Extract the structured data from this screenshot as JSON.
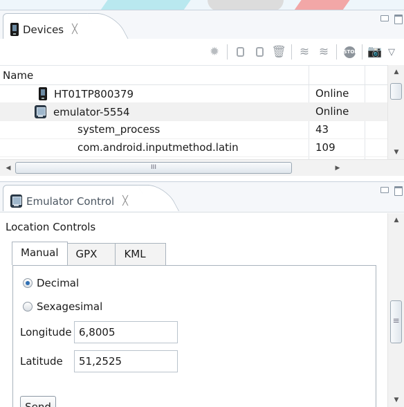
{
  "devices_view": {
    "tab_title": "Devices",
    "close_glyph": "╳",
    "toolbar_icons": [
      "debug-icon",
      "heap-icon",
      "heap-dump-icon",
      "gc-icon",
      "threads-icon",
      "thread-update-icon",
      "stop-process-icon",
      "screen-capture-icon",
      "view-menu-icon"
    ],
    "table": {
      "headers": [
        "Name"
      ],
      "rows": [
        {
          "name": "HT01TP800379",
          "status": "Online",
          "icon": "phone-device-icon"
        },
        {
          "name": "emulator-5554",
          "status": "Online",
          "icon": "emulator-device-icon"
        },
        {
          "name": "system_process",
          "status": "43",
          "icon": ""
        },
        {
          "name": "com.android.inputmethod.latin",
          "status": "109",
          "icon": ""
        }
      ]
    },
    "hscroll_grip": "III"
  },
  "emulator_control": {
    "tab_title": "Emulator Control",
    "close_glyph": "╳",
    "section_title": "Location Controls",
    "tabs": [
      {
        "label": "Manual",
        "active": true
      },
      {
        "label": "GPX",
        "active": false
      },
      {
        "label": "KML",
        "active": false
      }
    ],
    "format_options": [
      {
        "label": "Decimal",
        "selected": true
      },
      {
        "label": "Sexagesimal",
        "selected": false
      }
    ],
    "longitude": {
      "label": "Longitude",
      "value": "6,8005"
    },
    "latitude": {
      "label": "Latitude",
      "value": "51,2525"
    },
    "send_label": "Send",
    "scroll_grip": "≡"
  },
  "colors": {
    "border": "#b7c2cd",
    "selected_row": "#f1f1f1",
    "radio_dot": "#2f6fb3"
  }
}
